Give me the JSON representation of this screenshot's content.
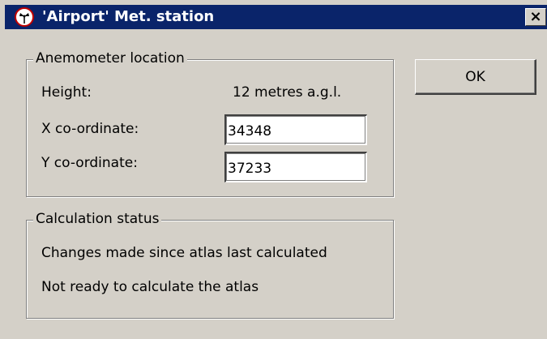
{
  "window": {
    "title": "'Airport' Met. station",
    "close_label": "×"
  },
  "anemometer": {
    "legend": "Anemometer location",
    "height_label": "Height:",
    "height_value": "12 metres a.g.l.",
    "x_label": "X co-ordinate:",
    "x_value": "34348",
    "y_label": "Y co-ordinate:",
    "y_value": "37233"
  },
  "status": {
    "legend": "Calculation status",
    "line1": "Changes made since atlas last calculated",
    "line2": "Not ready to calculate the atlas"
  },
  "buttons": {
    "ok_label": "OK"
  },
  "icons": {
    "title_icon": "anemometer-icon",
    "close_icon": "close-icon"
  }
}
